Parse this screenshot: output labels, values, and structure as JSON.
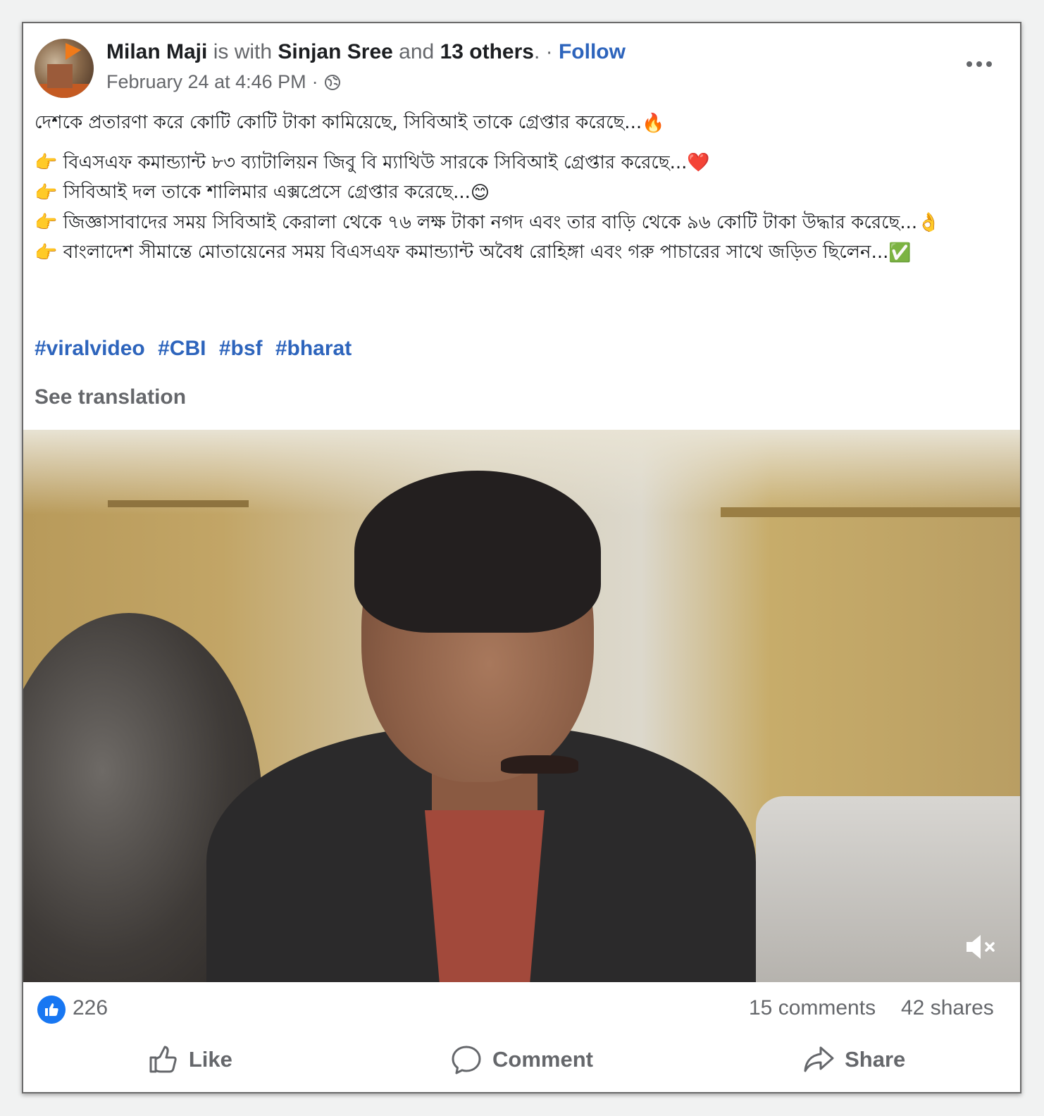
{
  "post": {
    "author": "Milan Maji",
    "with_text": "is with",
    "tagged": "Sinjan Sree",
    "and_text": "and",
    "others": "13 others",
    "separator": ". ·",
    "follow_label": "Follow",
    "timestamp": "February 24 at 4:46 PM",
    "dot": "·",
    "audience_icon": "globe-icon",
    "more_icon": "more-options-icon"
  },
  "content": {
    "headline": "দেশকে প্রতারণা করে কোটি কোটি টাকা কামিয়েছে, সিবিআই তাকে গ্রেপ্তার করেছে...",
    "bullets": [
      {
        "text": "বিএসএফ কমান্ড্যান্ট ৮৩ ব্যাটালিয়ন জিবু বি ম্যাথিউ সারকে সিবিআই গ্রেপ্তার করেছে...",
        "emoji": "❤️"
      },
      {
        "text": "সিবিআই দল তাকে শালিমার এক্সপ্রেসে গ্রেপ্তার করেছে...",
        "emoji": "😊"
      },
      {
        "text": "জিজ্ঞাসাবাদের সময় সিবিআই কেরালা থেকে ৭৬ লক্ষ টাকা নগদ এবং তার বাড়ি থেকে ৯৬ কোটি টাকা উদ্ধার করেছে...",
        "emoji": "👌"
      },
      {
        "text": "বাংলাদেশ সীমান্তে মোতায়েনের সময় বিএসএফ কমান্ড্যান্ট অবৈধ রোহিঙ্গা এবং গরু পাচারের সাথে জড়িত ছিলেন...",
        "emoji": "✅"
      }
    ],
    "headline_emoji": "🔥",
    "bullet_emoji": "👉",
    "hashtags": [
      "#viralvideo",
      "#CBI",
      "#bsf",
      "#bharat"
    ],
    "see_translation": "See translation"
  },
  "video": {
    "mute_icon": "muted-speaker-icon"
  },
  "stats": {
    "likes": "226",
    "comments": "15 comments",
    "shares": "42 shares"
  },
  "actions": {
    "like": "Like",
    "comment": "Comment",
    "share": "Share"
  },
  "colors": {
    "link_blue": "#2d64bc",
    "muted_text": "#65676b",
    "like_badge": "#1877f2"
  }
}
